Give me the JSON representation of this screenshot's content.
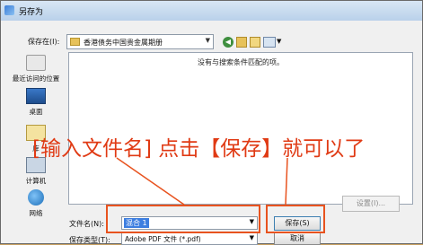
{
  "window": {
    "title": "另存为"
  },
  "location": {
    "label": "保存在(I):",
    "current_folder": "香港债务中国贵金属期册"
  },
  "toolbar": {
    "icons": [
      "back-icon",
      "up-folder-icon",
      "new-folder-icon",
      "views-menu-icon"
    ]
  },
  "places": [
    {
      "label": "最近访问的位置",
      "icon": "recent-places-icon"
    },
    {
      "label": "桌面",
      "icon": "desktop-icon"
    },
    {
      "label": "库",
      "icon": "libraries-icon"
    },
    {
      "label": "计算机",
      "icon": "computer-icon"
    },
    {
      "label": "网络",
      "icon": "network-icon"
    }
  ],
  "file_list": {
    "empty_message": "没有与搜索条件匹配的项。"
  },
  "settings_button": "设置(I)...",
  "filename": {
    "label": "文件名(N):",
    "value": "混合 1"
  },
  "save_type": {
    "label": "保存类型(T):",
    "value": "Adobe PDF 文件 (*.pdf)"
  },
  "buttons": {
    "save": "保存(S)",
    "cancel": "取消"
  },
  "annotation": {
    "text": "[输入文件名] 点击【保存】就可以了",
    "color": "#e03a14"
  },
  "colors": {
    "highlight": "#e8531f",
    "selection": "#3d7ee0"
  }
}
